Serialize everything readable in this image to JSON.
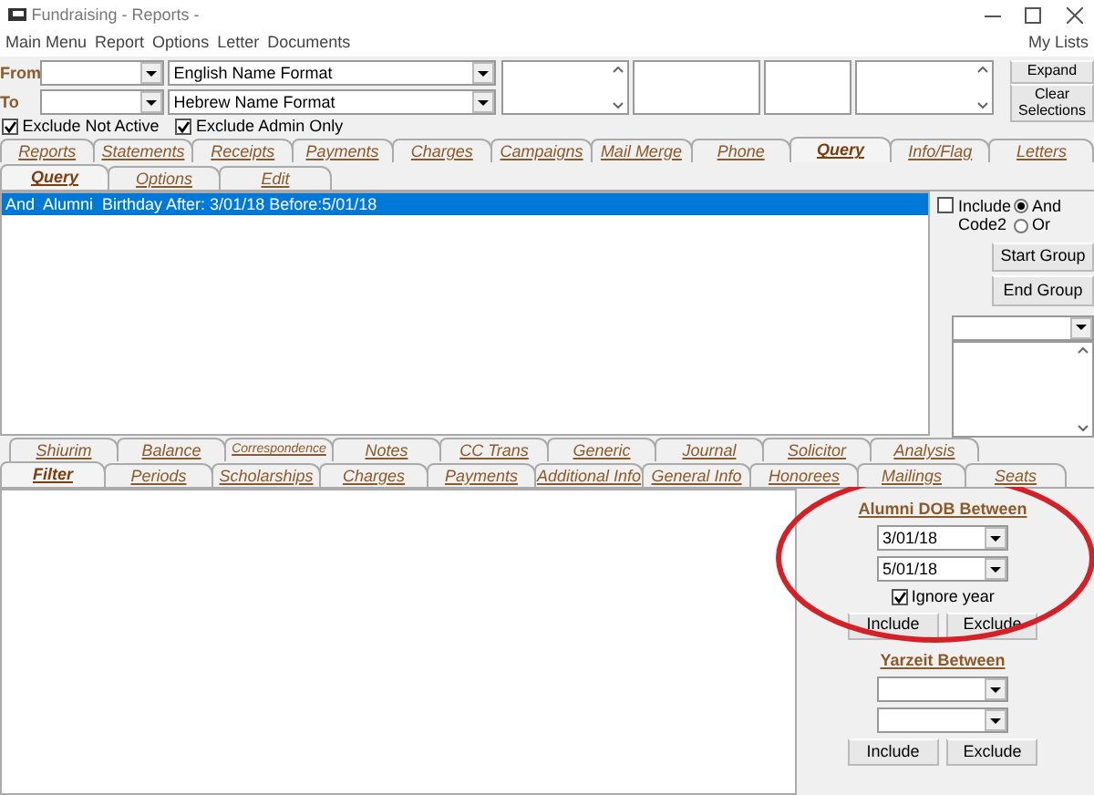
{
  "window": {
    "title": "Fundraising - Reports -"
  },
  "menu": [
    "Main Menu",
    "Report",
    "Options",
    "Letter",
    "Documents"
  ],
  "my_lists": "My Lists",
  "range_labels": [
    "From",
    "To"
  ],
  "name_formats": [
    "English Name Format",
    "Hebrew Name Format"
  ],
  "list_boxes": [
    {
      "scrollbar": true
    },
    {
      "scrollbar": false
    },
    {
      "scrollbar": false
    },
    {
      "scrollbar": true
    }
  ],
  "top_buttons": [
    "Expand",
    "Clear Selections"
  ],
  "checks": [
    {
      "label": "Exclude Not Active",
      "checked": true
    },
    {
      "label": "Exclude Admin Only",
      "checked": true
    }
  ],
  "main_tabs": [
    {
      "label": "Reports",
      "selected": false
    },
    {
      "label": "Statements",
      "selected": false
    },
    {
      "label": "Receipts",
      "selected": false
    },
    {
      "label": "Payments",
      "selected": false
    },
    {
      "label": "Charges",
      "selected": false
    },
    {
      "label": "Campaigns",
      "selected": false
    },
    {
      "label": "Mail Merge",
      "selected": false
    },
    {
      "label": "Phone",
      "selected": false
    },
    {
      "label": "Query",
      "selected": true
    },
    {
      "label": "Info/Flag",
      "selected": false
    },
    {
      "label": "Letters",
      "selected": false
    }
  ],
  "query_tabs": [
    {
      "label": "Query",
      "selected": true
    },
    {
      "label": "Options",
      "selected": false
    },
    {
      "label": "Edit",
      "selected": false
    }
  ],
  "query_rows": [
    {
      "text": "And  Alumni  Birthday After: 3/01/18 Before:5/01/18",
      "selected": true
    }
  ],
  "query_panel": {
    "include_code2": {
      "label": "Include Code2",
      "checked": false
    },
    "logic": [
      {
        "label": "And",
        "selected": true
      },
      {
        "label": "Or",
        "selected": false
      }
    ],
    "buttons": [
      "Start Group",
      "End Group"
    ]
  },
  "filter_tabs_back": [
    {
      "label": "Shiurim",
      "selected": false
    },
    {
      "label": "Balance",
      "selected": false
    },
    {
      "label": "Correspondence",
      "selected": false
    },
    {
      "label": "Notes",
      "selected": false
    },
    {
      "label": "CC Trans",
      "selected": false
    },
    {
      "label": "Generic",
      "selected": false
    },
    {
      "label": "Journal",
      "selected": false
    },
    {
      "label": "Solicitor",
      "selected": false
    },
    {
      "label": "Analysis",
      "selected": false
    }
  ],
  "filter_tabs_front": [
    {
      "label": "Filter",
      "selected": true
    },
    {
      "label": "Periods",
      "selected": false
    },
    {
      "label": "Scholarships",
      "selected": false
    },
    {
      "label": "Charges",
      "selected": false
    },
    {
      "label": "Payments",
      "selected": false
    },
    {
      "label": "Additional Info",
      "selected": false
    },
    {
      "label": "General Info",
      "selected": false
    },
    {
      "label": "Honorees",
      "selected": false
    },
    {
      "label": "Mailings",
      "selected": false
    },
    {
      "label": "Seats",
      "selected": false
    }
  ],
  "filters": [
    {
      "title": "Alumni DOB Between",
      "from": "3/01/18",
      "to": "5/01/18",
      "ignore_year": {
        "label": "Ignore year",
        "checked": true
      },
      "buttons": [
        "Include",
        "Exclude"
      ]
    },
    {
      "title": "Yarzeit Between",
      "buttons": [
        "Include",
        "Exclude"
      ]
    }
  ],
  "annotation": {
    "kind": "circle"
  }
}
